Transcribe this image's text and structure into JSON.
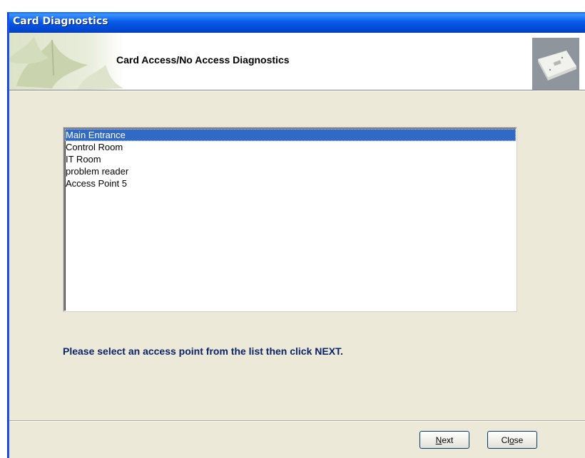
{
  "window": {
    "title": "Card Diagnostics"
  },
  "banner": {
    "heading": "Card Access/No Access Diagnostics"
  },
  "access_points": {
    "selected_index": 0,
    "items": [
      "Main Entrance",
      "Control Room",
      "IT Room",
      "problem reader",
      "Access Point 5"
    ]
  },
  "instruction": "Please select an access point from the list then click NEXT.",
  "buttons": {
    "next": {
      "pre": "",
      "mnemonic": "N",
      "post": "ext"
    },
    "close": {
      "pre": "Cl",
      "mnemonic": "o",
      "post": "se"
    }
  },
  "colors": {
    "selection": "#316AC5",
    "instruction_text": "#0A246A",
    "dialog_bg": "#ECE9D8"
  }
}
